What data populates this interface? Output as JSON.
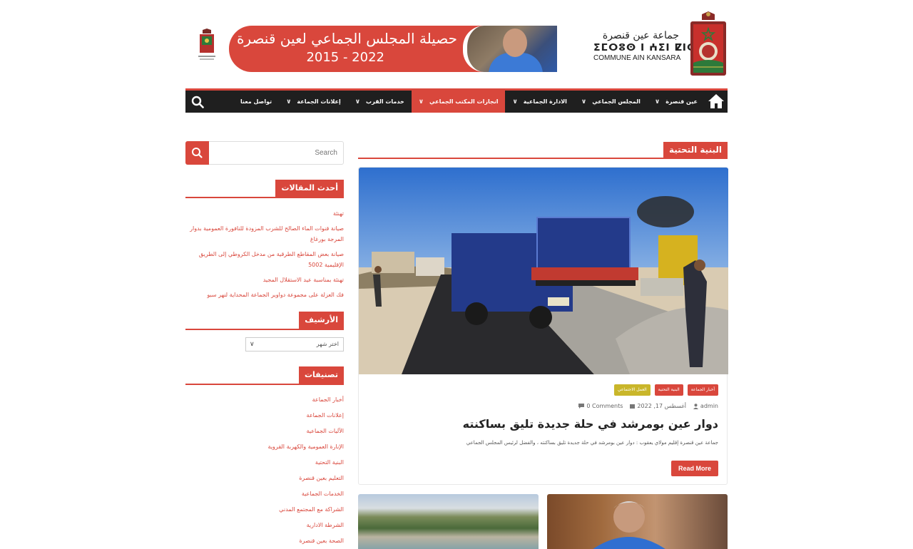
{
  "header": {
    "banner_title": "حصيلة المجلس الجماعي لعين قنصرة",
    "banner_years": "2015 - 2022",
    "brand_ar": "جماعة عين قنصرة",
    "brand_tf": "ⵉⵎⵔⵓⵙ ⵏ ⵄⵉⵏ ⵇⵏⵚⵔⴰ",
    "brand_fr": "COMMUNE AIN KANSARA"
  },
  "nav": {
    "items": [
      {
        "label": "عين قنصرة",
        "has_dropdown": true,
        "active": false
      },
      {
        "label": "المجلس الجماعي",
        "has_dropdown": true,
        "active": false
      },
      {
        "label": "الادارة الجماعية",
        "has_dropdown": true,
        "active": false
      },
      {
        "label": "انجازات المكتب الجماعي",
        "has_dropdown": true,
        "active": true
      },
      {
        "label": "خدمات القرب",
        "has_dropdown": true,
        "active": false
      },
      {
        "label": "إعلانات الجماعة",
        "has_dropdown": true,
        "active": false
      },
      {
        "label": "تواصل معنا",
        "has_dropdown": false,
        "active": false
      }
    ]
  },
  "sidebar": {
    "search_placeholder": "Search",
    "recent_title": "أحدث المقالات",
    "recent_posts": [
      "تهنئة",
      "صيانة قنوات الماء الصالح للشرب المزودة للنافورة العمومية بدوار المرجة بورغاغ",
      "صيانة بعض المقاطع الطرقية من مدخل الكروطي إلى الطريق الإقليمية 5002",
      "تهنئة بمناسبة عيد الاستقلال المجيد",
      "فك العزلة على مجموعة دواوير الجماعة المحداية لنهر سبو"
    ],
    "archive_title": "الأرشيف",
    "archive_select": "اختر شهر",
    "categories_title": "تصنيفات",
    "categories": [
      "أخبار الجماعة",
      "إعلانات الجماعة",
      "الآليات الجماعية",
      "الإنارة العمومية والكهربة القروية",
      "البنية التحتية",
      "التعليم بعين قنصرة",
      "الخدمات الجماعية",
      "الشراكة مع المجتمع المدني",
      "الشرطة الادارية",
      "الصحة بعين قنصرة"
    ]
  },
  "main": {
    "section_title": "البنية التحتية",
    "post": {
      "tags": [
        {
          "label": "أخبار الجماعة",
          "color": "#d9473c"
        },
        {
          "label": "البنية التحتية",
          "color": "#d9473c"
        },
        {
          "label": "العمل الاجتماعي",
          "color": "#c9b62a"
        }
      ],
      "author": "admin",
      "date": "أغسطس 17, 2022",
      "comments": "0 Comments",
      "title": "دوار عين بومرشد في حلة جديدة تليق بساكنته",
      "excerpt": "جماعة عين قنصرة إقليم مولاي يعقوب : دوار عين بومرشد في حلة جديدة تليق بساكنته ، والفضل لرئيس المجلس الجماعي",
      "read_more": "Read More"
    }
  },
  "colors": {
    "accent": "#d9473c",
    "nav_bg": "#1f1f1f",
    "tag_yellow": "#c9b62a"
  }
}
